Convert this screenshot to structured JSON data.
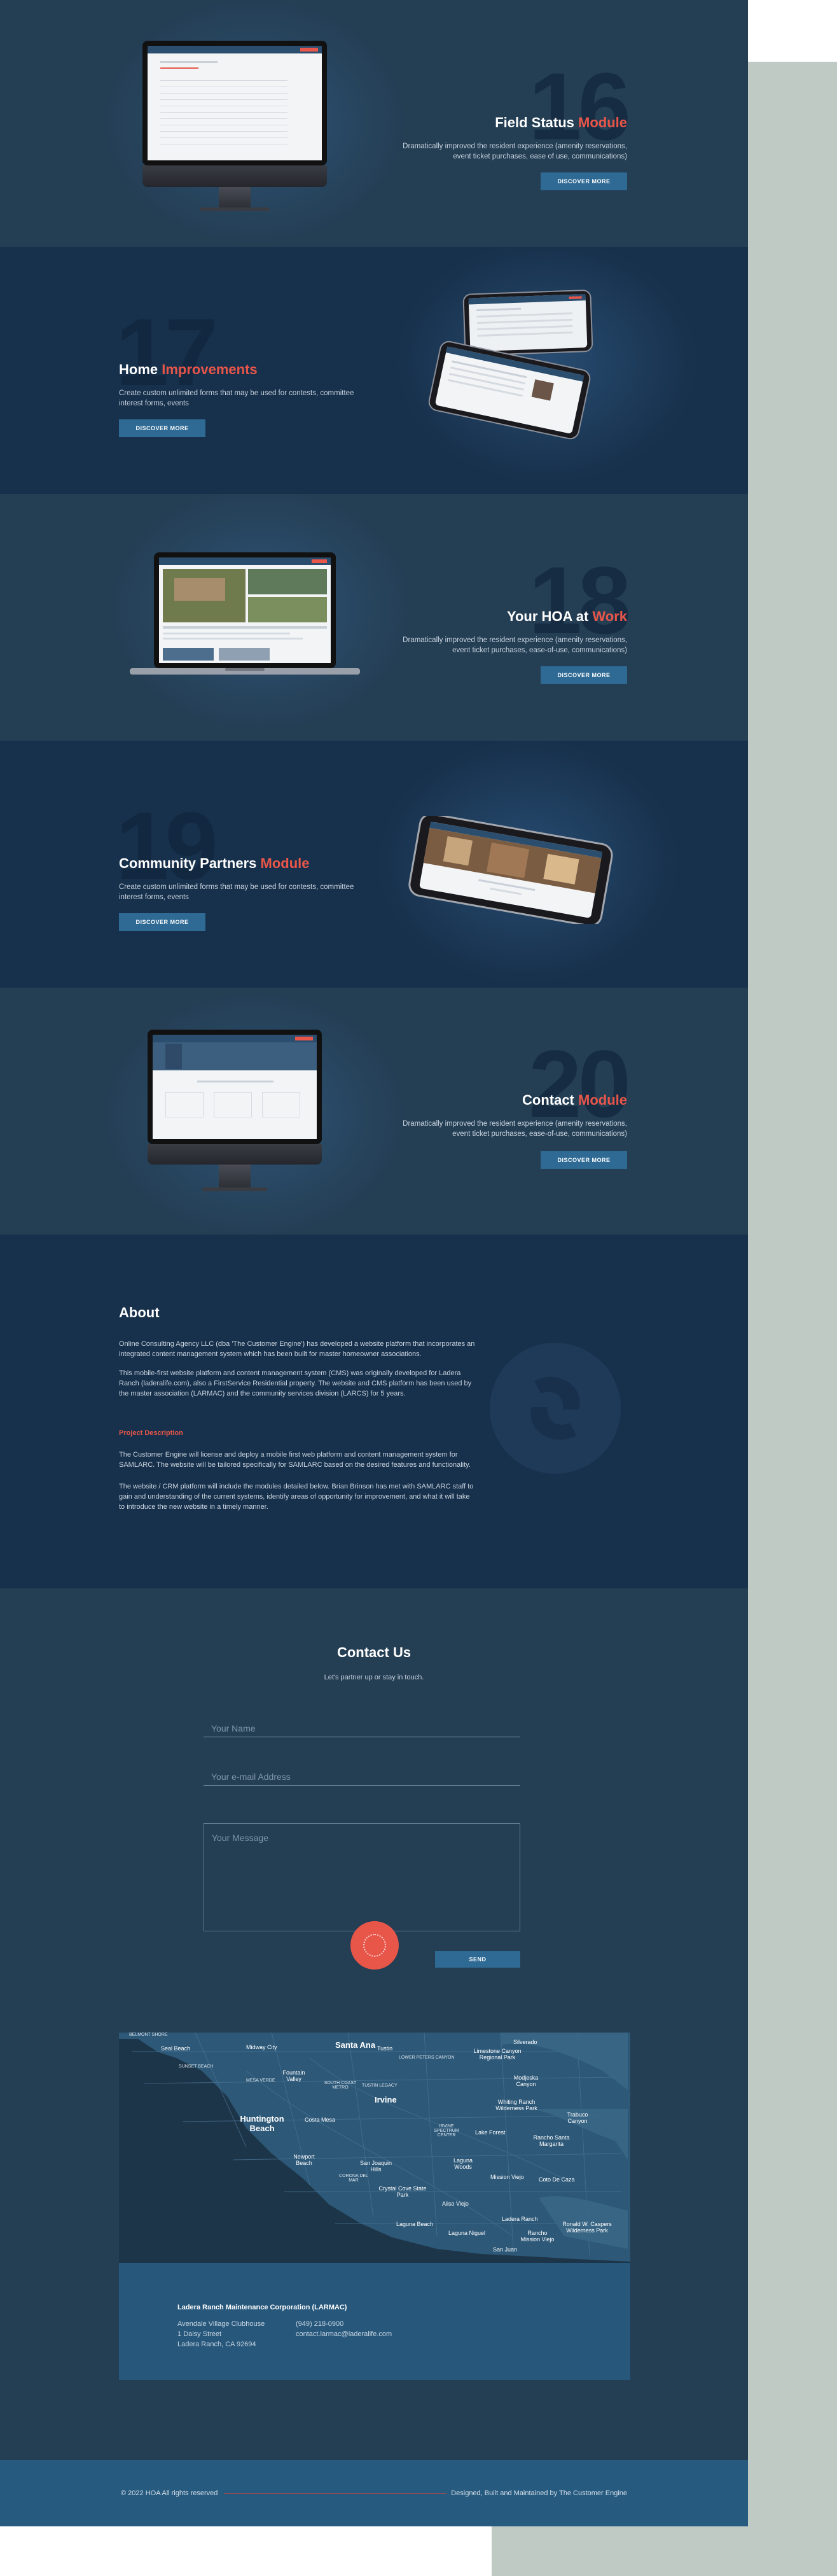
{
  "features": [
    {
      "num": "16",
      "title": "Field Status ",
      "accent": "Module",
      "desc": "Dramatically improved the resident experience (amenity reservations, event ticket purchases, ease of use, communications)",
      "button": "DISCOVER MORE"
    },
    {
      "num": "17",
      "title": "Home ",
      "accent": "Improvements",
      "desc": "Create custom unlimited forms that may be used for contests, committee interest forms, events",
      "button": "DISCOVER MORE"
    },
    {
      "num": "18",
      "title": "Your HOA at ",
      "accent": "Work",
      "desc": "Dramatically improved the resident experience (amenity reservations, event ticket purchases, ease-of-use, communications)",
      "button": "DISCOVER MORE"
    },
    {
      "num": "19",
      "title": "Community Partners ",
      "accent": "Module",
      "desc": "Create custom unlimited forms that may be used for contests, committee interest forms, events",
      "button": "DISCOVER MORE"
    },
    {
      "num": "20",
      "title": "Contact ",
      "accent": "Module",
      "desc": "Dramatically improved the resident experience (amenity reservations, event ticket purchases, ease-of-use, communications)",
      "button": "DISCOVER MORE"
    }
  ],
  "about": {
    "heading": "About",
    "p1": "Online Consulting Agency LLC (dba 'The Customer Engine') has developed a website platform that incorporates an integrated content management system which has been built for master homeowner associations.",
    "p2": "This mobile-first website platform and content management system (CMS) was originally developed for Ladera Ranch (laderalife.com), also a FirstService Residential property. The website and CMS platform has been used by the master association (LARMAC) and the community services division (LARCS) for 5 years.",
    "subheading": "Project Description",
    "p3": "The Customer Engine will license and deploy a mobile first web platform and content management system for SAMLARC. The website will be tailored specifically for SAMLARC based on the desired features and functionality.",
    "p4": "The website / CRM platform will include the modules detailed below. Brian Brinson has met with SAMLARC staff to gain and understanding of the current systems, identify areas of opportunity for improvement, and what it will take to introduce the new website in a timely manner."
  },
  "contact": {
    "heading": "Contact Us",
    "tagline": "Let's partner up or stay in touch.",
    "name_placeholder": "Your Name",
    "email_placeholder": "Your e-mail Address",
    "message_placeholder": "Your Message",
    "send": "SEND"
  },
  "map": {
    "labels": [
      "BELMONT SHORE",
      "Seal Beach",
      "SUNSET BEACH",
      "Midway City",
      "Santa Ana",
      "Tustin",
      "LOWER PETERS CANYON",
      "Silverado",
      "Limestone Canyon Regional Park",
      "Modjeska Canyon",
      "Fountain Valley",
      "MESA VERDE",
      "SOUTH COAST METRO",
      "TUSTIN LEGACY",
      "Irvine",
      "Huntington Beach",
      "Costa Mesa",
      "Whiting Ranch Wilderness Park",
      "Trabuco Canyon",
      "Lake Forest",
      "IRVINE SPECTRUM CENTER",
      "Rancho Santa Margarita",
      "Newport Beach",
      "Laguna Woods",
      "Mission Viejo",
      "Coto De Caza",
      "San Joaquin Hills",
      "CORONA DEL MAR",
      "Crystal Cove State Park",
      "Aliso Viejo",
      "Ladera Ranch",
      "Laguna Beach",
      "Laguna Niguel",
      "Rancho Mission Viejo",
      "Ronald W. Caspers Wilderness Park",
      "San Juan"
    ]
  },
  "address": {
    "org": "Ladera Ranch Maintenance Corporation (LARMAC)",
    "line1": "Avendale Village Clubhouse",
    "line2": "1 Daisy Street",
    "line3": "Ladera Ranch, CA 92694",
    "phone": "(949) 218-0900",
    "email": "contact.larmac@laderalife.com"
  },
  "footer": {
    "copyright": "© 2022 HOA All rights reserved",
    "credit": "Designed, Built and Maintained by The Customer Engine"
  },
  "colors": {
    "accent": "#e8564a",
    "button": "#2f6a94",
    "navy": "#17304b",
    "slate": "#243e54"
  }
}
